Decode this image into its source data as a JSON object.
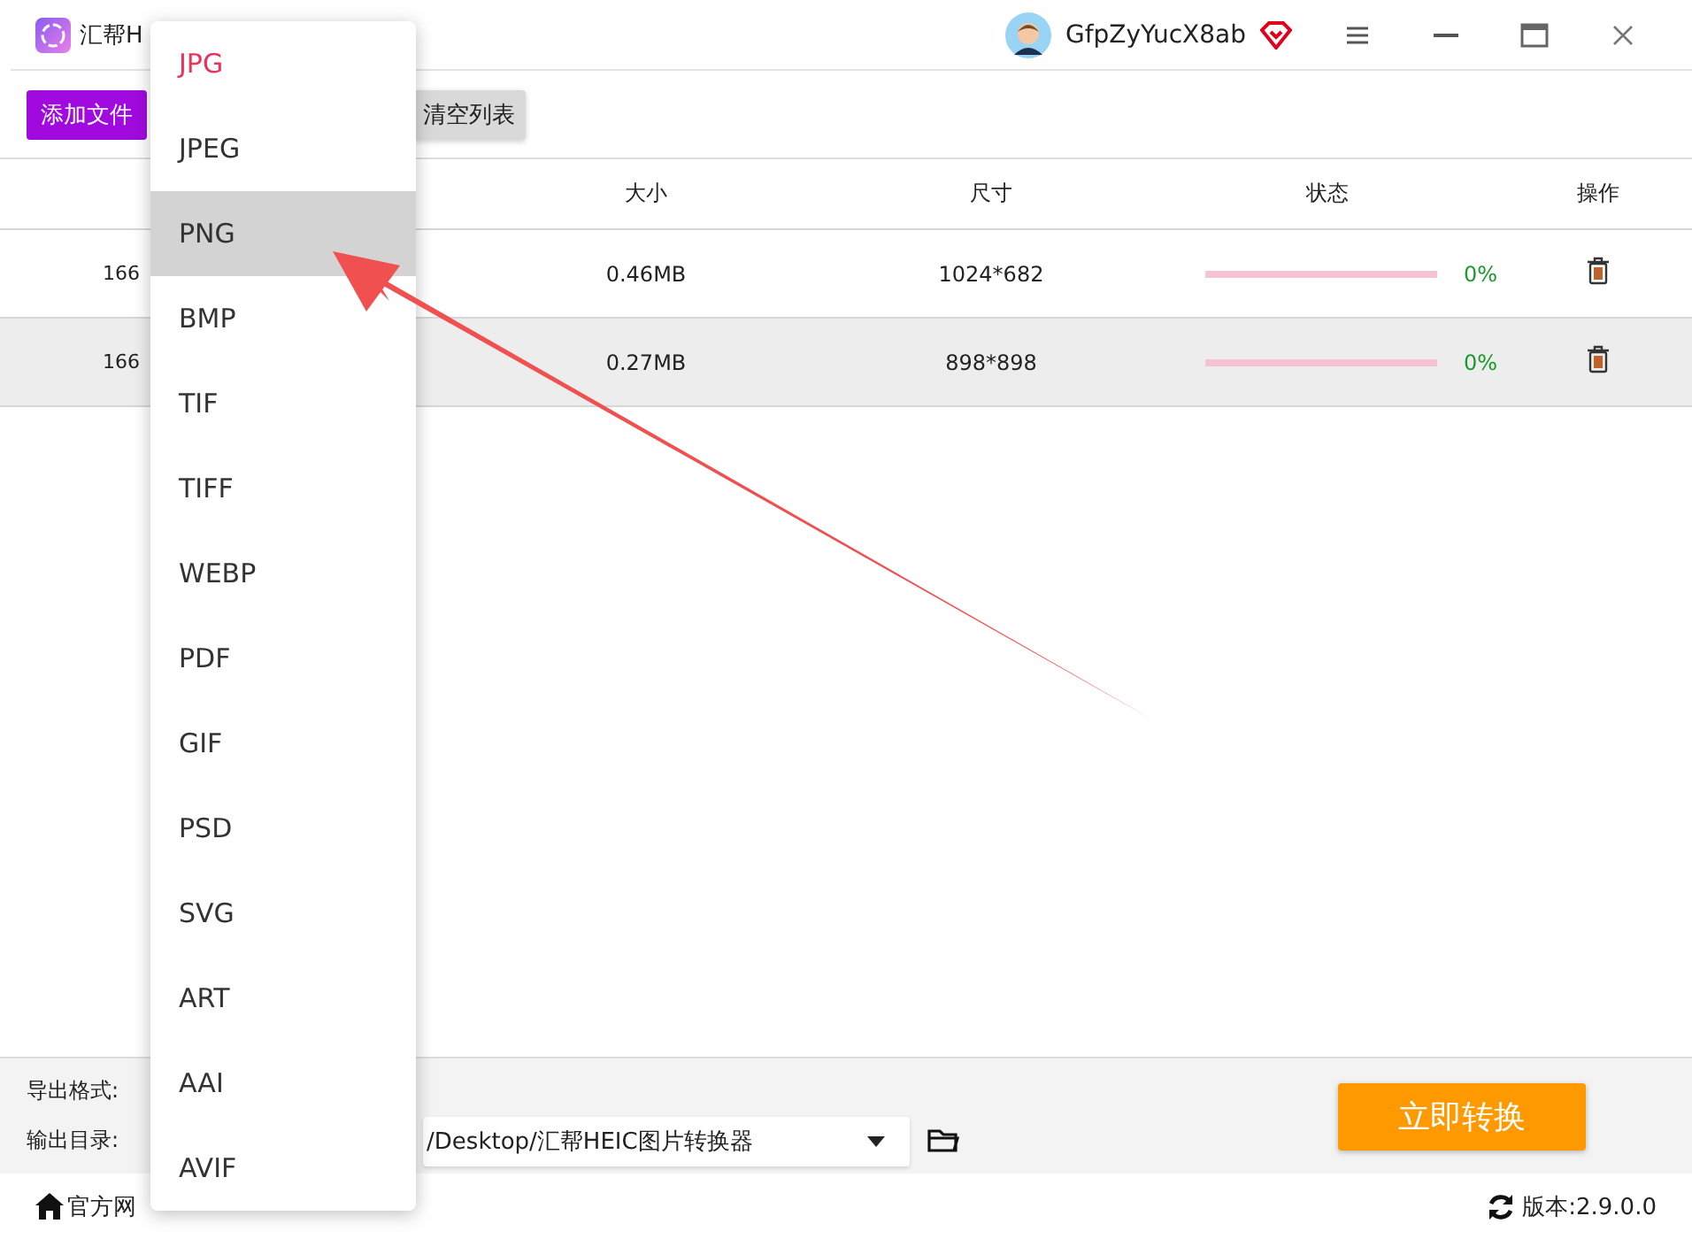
{
  "window": {
    "title": "汇帮H",
    "user": "GfpZyYucX8ab"
  },
  "toolbar": {
    "add_button": "添加文件",
    "clear_button": "清空列表"
  },
  "table": {
    "columns": [
      "大小",
      "尺寸",
      "状态",
      "操作"
    ],
    "rows": [
      {
        "name": "166",
        "size": "0.46MB",
        "dims": "1024*682",
        "level": 0,
        "percent": "0%",
        "selected": false
      },
      {
        "name": "166",
        "size": "0.27MB",
        "dims": "898*898",
        "level": 0,
        "percent": "0%",
        "selected": true
      }
    ]
  },
  "settings": {
    "format_label": "导出格式:",
    "dir_label": "输出目录:",
    "dir_value": "/Desktop/汇帮HEIC图片转换器",
    "convert_button": "立即转换"
  },
  "footer": {
    "website": "官方网",
    "version": "版本:2.9.0.0"
  },
  "format_menu": [
    {
      "label": "JPG",
      "selected": true,
      "hovered": false
    },
    {
      "label": "JPEG",
      "selected": false,
      "hovered": false
    },
    {
      "label": "PNG",
      "selected": false,
      "hovered": true
    },
    {
      "label": "BMP",
      "selected": false,
      "hovered": false
    },
    {
      "label": "TIF",
      "selected": false,
      "hovered": false
    },
    {
      "label": "TIFF",
      "selected": false,
      "hovered": false
    },
    {
      "label": "WEBP",
      "selected": false,
      "hovered": false
    },
    {
      "label": "PDF",
      "selected": false,
      "hovered": false
    },
    {
      "label": "GIF",
      "selected": false,
      "hovered": false
    },
    {
      "label": "PSD",
      "selected": false,
      "hovered": false
    },
    {
      "label": "SVG",
      "selected": false,
      "hovered": false
    },
    {
      "label": "ART",
      "selected": false,
      "hovered": false
    },
    {
      "label": "AAI",
      "selected": false,
      "hovered": false
    },
    {
      "label": "AVIF",
      "selected": false,
      "hovered": false
    }
  ]
}
